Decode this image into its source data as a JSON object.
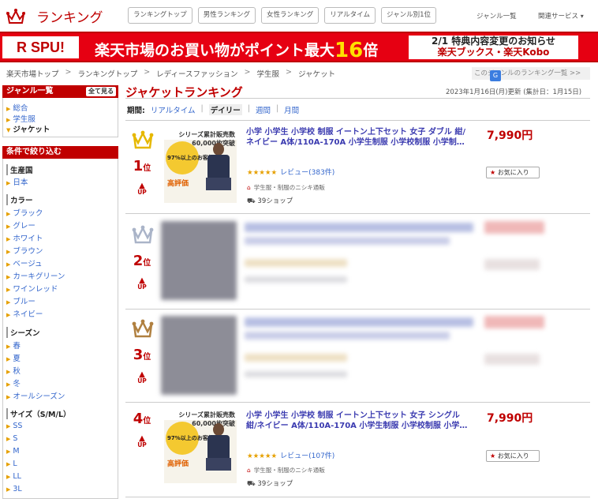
{
  "header": {
    "logo_text": "ランキング",
    "nav": [
      "ランキングトップ",
      "男性ランキング",
      "女性ランキング",
      "リアルタイム",
      "ジャンル別1位"
    ],
    "genre_list": "ジャンル一覧",
    "related": "関連サービス"
  },
  "banner": {
    "spu": "R SPU!",
    "promo_main": "楽天市場のお買い物がポイント最大",
    "promo_num": "16",
    "promo_unit": "倍",
    "notice_line1": "2/1 特典内容変更のお知らせ",
    "notice_line2": "楽天ブックス・楽天Kobo"
  },
  "breadcrumb": [
    "楽天市場トップ",
    "ランキングトップ",
    "レディースファッション",
    "学生服",
    "ジャケット"
  ],
  "breadcrumb_sep": ">",
  "other_ranking": "このジャンルのランキング一覧 >>",
  "sidebar": {
    "genre_title": "ジャンル一覧",
    "show_all": "全て見る",
    "genres": [
      "総合",
      "学生服",
      "ジャケット"
    ],
    "filter_title": "条件で絞り込む",
    "production": {
      "label": "生産国",
      "items": [
        "日本"
      ]
    },
    "color": {
      "label": "カラー",
      "items": [
        "ブラック",
        "グレー",
        "ホワイト",
        "ブラウン",
        "ベージュ",
        "カーキグリーン",
        "ワインレッド",
        "ブルー",
        "ネイビー"
      ]
    },
    "season": {
      "label": "シーズン",
      "items": [
        "春",
        "夏",
        "秋",
        "冬",
        "オールシーズン"
      ]
    },
    "size": {
      "label": "サイズ（S/M/L）",
      "items": [
        "SS",
        "S",
        "M",
        "L",
        "LL",
        "3L"
      ]
    }
  },
  "main": {
    "title": "ジャケットランキング",
    "updated": "2023年1月16日(月)更新 (集計日：1月15日)",
    "period_label": "期間:",
    "periods": [
      "リアルタイム",
      "デイリー",
      "週間",
      "月間"
    ],
    "period_bar": "|",
    "rank_suffix": "位",
    "up": "UP",
    "fav_label": "お気に入り",
    "items": [
      {
        "rank": "1",
        "title": "小学 小学生 小学校 制服 イートン上下セット 女子 ダブル 紺/ネイビー A体/110A-170A 小学生制服 小学校制服 小学制…",
        "stars": "★★★★★",
        "review": "レビュー(383件)",
        "shop": "学生服・制服のニシキ通販",
        "shops": "39ショップ",
        "price": "7,990円",
        "thumb_top": "シリーズ累計販売数 60,000枚突破",
        "thumb_pct": "97%以上のお客様から",
        "thumb_high": "高評価"
      },
      {
        "rank": "2"
      },
      {
        "rank": "3"
      },
      {
        "rank": "4",
        "title": "小学 小学生 小学校 制服 イートン上下セット 女子 シングル 紺/ネイビー A体/110A-170A 小学生制服 小学校制服 小学…",
        "stars": "★★★★★",
        "review": "レビュー(107件)",
        "shop": "学生服・制服のニシキ通販",
        "shops": "39ショップ",
        "price": "7,990円",
        "thumb_top": "シリーズ累計販売数 60,000枚突破",
        "thumb_pct": "97%以上のお客様から",
        "thumb_high": "高評価"
      }
    ]
  },
  "colors": {
    "accent": "#bf0000",
    "link": "#3366cc",
    "gold": "#e6b800",
    "silver": "#aab4c8",
    "bronze": "#b08040"
  }
}
